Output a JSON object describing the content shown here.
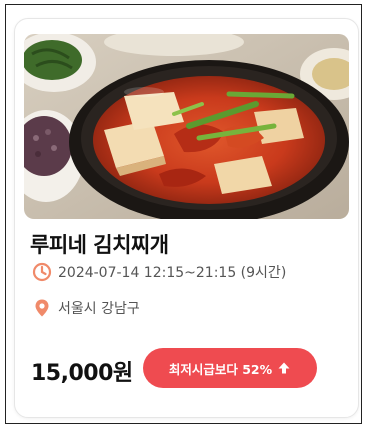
{
  "listing": {
    "title": "루피네 김치찌개",
    "time": "2024-07-14 12:15~21:15 (9시간)",
    "location": "서울시 강남구",
    "price": "15,000원",
    "badge": "최저시급보다 52%",
    "image_icon": "kimchi-stew-photo",
    "time_icon": "clock-icon",
    "location_icon": "location-pin-icon",
    "badge_icon": "arrow-up-icon"
  },
  "colors": {
    "accent": "#ef4b50",
    "icon": "#f08a6a",
    "title": "#111111",
    "meta_text": "#555555"
  }
}
